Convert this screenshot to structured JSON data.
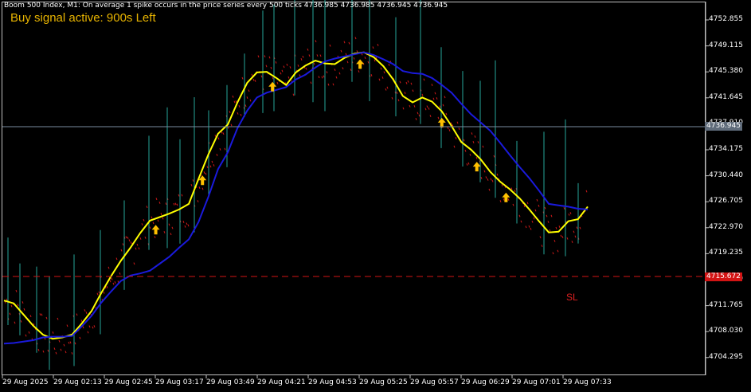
{
  "header": {
    "symbol_info": "Boom 500 Index, M1:  On average 1 spike occurs in the price series every 500 ticks  4736.985 4736.985 4736.945 4736.945"
  },
  "signal_text": "Buy signal active: 900s Left",
  "sl_label": "SL",
  "current_price": "4736.945",
  "sl_price": "4715.672",
  "colors": {
    "background": "#000000",
    "bull_candle": "#26a69a",
    "bear_candle": "#d41a1a",
    "fast_ma": "#ffff00",
    "slow_ma": "#1a1adc",
    "arrow": "#ffc000",
    "price_line": "#7a8ba0",
    "sl_line": "#d21414"
  },
  "chart_data": {
    "type": "line",
    "y_ticks": [
      "4752.855",
      "4749.115",
      "4745.380",
      "4741.645",
      "4737.910",
      "4734.175",
      "4730.440",
      "4726.705",
      "4722.970",
      "4719.235",
      "4715.500",
      "4711.765",
      "4708.030",
      "4704.295"
    ],
    "x_ticks": [
      "29 Aug 2025",
      "29 Aug 02:13",
      "29 Aug 02:45",
      "29 Aug 03:17",
      "29 Aug 03:49",
      "29 Aug 04:21",
      "29 Aug 04:53",
      "29 Aug 05:25",
      "29 Aug 05:57",
      "29 Aug 06:29",
      "29 Aug 07:01",
      "29 Aug 07:33"
    ],
    "ylim": [
      4701.5,
      4755.0
    ],
    "series": [
      {
        "color": "#ffff00",
        "values": [
          4712.5,
          4712.1,
          4710.5,
          4708.9,
          4707.6,
          4707.0,
          4707.2,
          4707.6,
          4709.2,
          4711.0,
          4713.6,
          4716.0,
          4718.2,
          4720.1,
          4722.2,
          4724.0,
          4724.5,
          4725.0,
          4725.6,
          4726.4,
          4730.0,
          4733.5,
          4736.5,
          4737.8,
          4741.0,
          4743.8,
          4745.3,
          4745.4,
          4744.5,
          4743.5,
          4745.3,
          4746.3,
          4747.0,
          4746.6,
          4746.5,
          4747.4,
          4748.0,
          4748.2,
          4747.5,
          4746.2,
          4744.3,
          4741.9,
          4741.0,
          4741.7,
          4741.1,
          4739.7,
          4737.6,
          4735.3,
          4734.2,
          4732.8,
          4731.0,
          4729.6,
          4728.5,
          4727.2,
          4725.6,
          4723.9,
          4722.3,
          4722.4,
          4723.9,
          4724.2,
          4726.0
        ]
      },
      {
        "color": "#1a1adc",
        "values": [
          4706.3,
          4706.4,
          4706.6,
          4706.8,
          4707.2,
          4707.3,
          4707.3,
          4707.4,
          4708.8,
          4710.3,
          4712.2,
          4713.8,
          4715.3,
          4716.1,
          4716.4,
          4716.8,
          4717.8,
          4718.8,
          4720.1,
          4721.3,
          4723.8,
          4727.4,
          4731.4,
          4733.8,
          4737.3,
          4739.8,
          4741.7,
          4742.4,
          4742.8,
          4743.2,
          4744.3,
          4745.0,
          4746.0,
          4746.9,
          4747.3,
          4747.6,
          4747.9,
          4748.2,
          4747.8,
          4747.2,
          4746.5,
          4745.5,
          4745.2,
          4745.1,
          4744.5,
          4743.5,
          4742.4,
          4740.8,
          4739.3,
          4738.1,
          4736.9,
          4735.2,
          4733.4,
          4731.7,
          4730.1,
          4728.3,
          4726.4,
          4726.2,
          4726.0,
          4725.7,
          4725.6
        ]
      }
    ],
    "arrows_at": [
      26,
      34,
      46,
      61,
      75,
      81,
      86
    ]
  }
}
